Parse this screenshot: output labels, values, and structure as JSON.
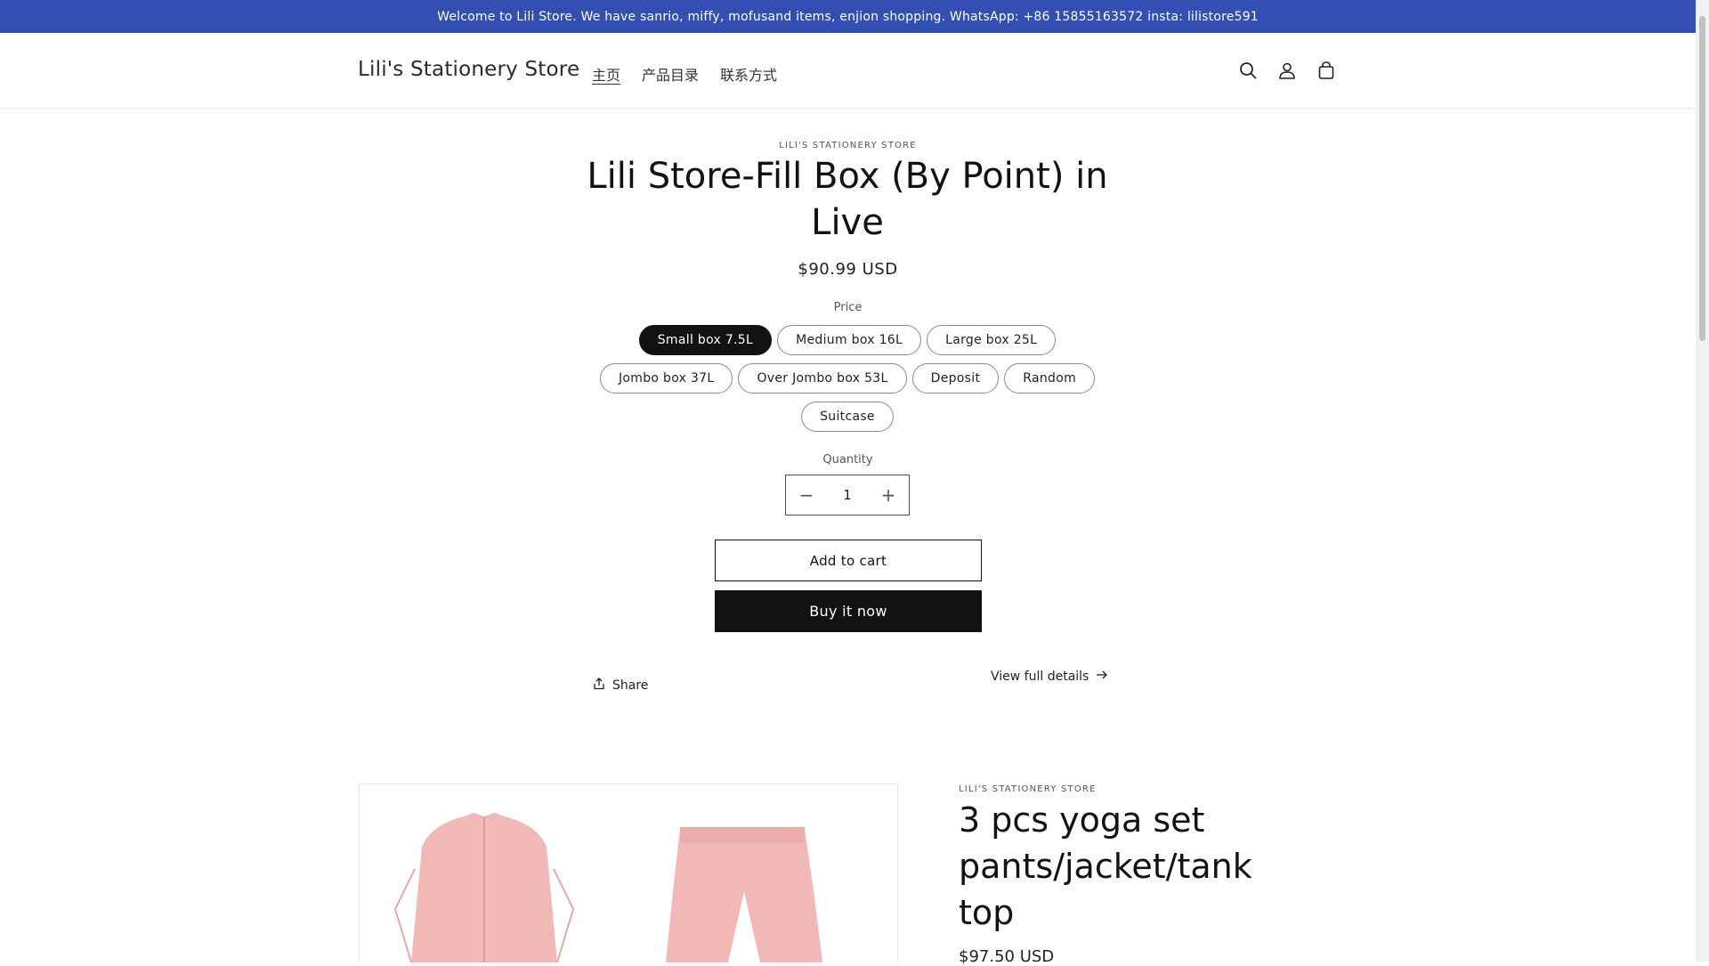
{
  "announcement": {
    "text": "Welcome to Lili Store. We have sanrio, miffy, mofusand items, enjion shopping. WhatsApp: +86 15855163572 insta: lilistore591",
    "background": "#334fb4"
  },
  "header": {
    "logo": "Lili's Stationery Store",
    "nav": [
      {
        "label": "主页",
        "active": true
      },
      {
        "label": "产品目录",
        "active": false
      },
      {
        "label": "联系方式",
        "active": false
      }
    ],
    "icons": [
      "search-icon",
      "account-icon",
      "cart-icon"
    ]
  },
  "product": {
    "vendor": "LILI'S STATIONERY STORE",
    "title": "Lili Store-Fill Box (By Point) in Live",
    "price": "$90.99 USD",
    "option_label": "Price",
    "variants": [
      {
        "label": "Small box 7.5L",
        "selected": true
      },
      {
        "label": "Medium box 16L",
        "selected": false
      },
      {
        "label": "Large box 25L",
        "selected": false
      },
      {
        "label": "Jombo box 37L",
        "selected": false
      },
      {
        "label": "Over Jombo box 53L",
        "selected": false
      },
      {
        "label": "Deposit",
        "selected": false
      },
      {
        "label": "Random",
        "selected": false
      },
      {
        "label": "Suitcase",
        "selected": false
      }
    ],
    "quantity_label": "Quantity",
    "quantity_value": "1",
    "quantity_minus": "−",
    "quantity_plus": "+",
    "add_to_cart": "Add to cart",
    "buy_now": "Buy it now",
    "share": "Share",
    "view_details": "View full details"
  },
  "product2": {
    "vendor": "LILI'S STATIONERY STORE",
    "title": "3 pcs yoga set pants/jacket/tank top",
    "price": "$97.50 USD",
    "image_color": "#f2b8b5"
  }
}
